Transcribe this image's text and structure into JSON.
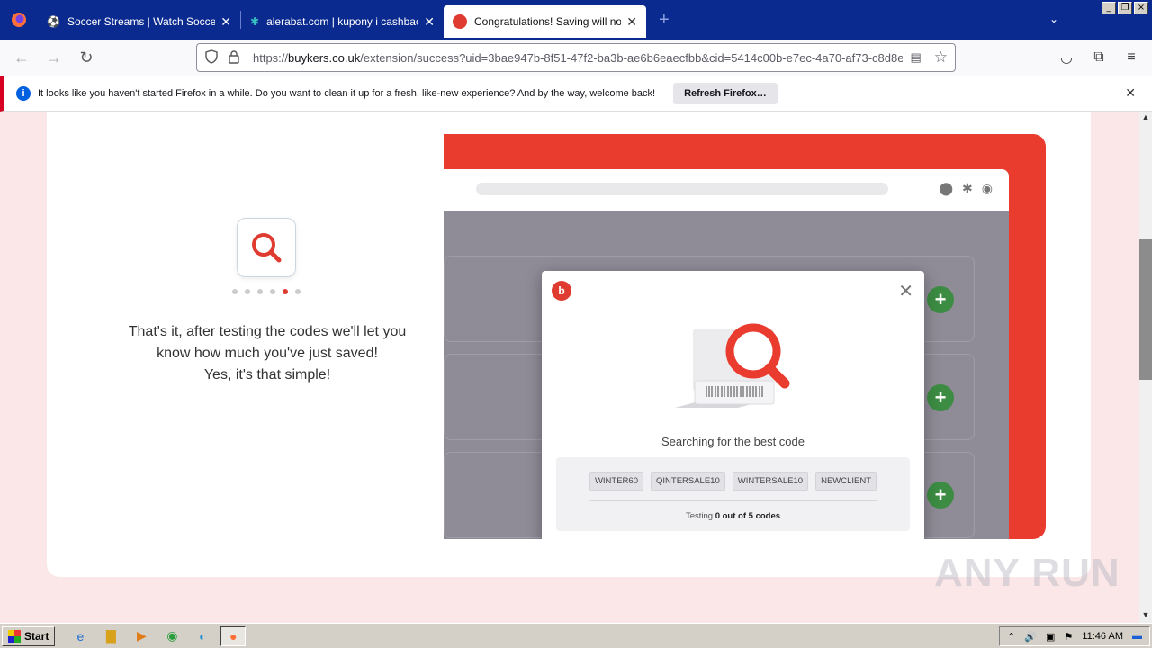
{
  "browser": {
    "tabs": [
      {
        "title": "Soccer Streams | Watch Soccer Or",
        "icon": "soccer-ball-icon"
      },
      {
        "title": "alerabat.com | kupony i cashback",
        "icon": "alerabat-icon"
      },
      {
        "title": "Congratulations! Saving will now b",
        "icon": "buykers-icon",
        "active": true
      }
    ],
    "new_tab": "+",
    "url_prefix": "https://",
    "url_host": "buykers.co.uk",
    "url_path": "/extension/success?uid=3bae947b-8f51-47f2-ba3b-ae6b6eaecfbb&cid=5414c00b-e7ec-4a70-af73-c8d8e"
  },
  "notification": {
    "message": "It looks like you haven't started Firefox in a while. Do you want to clean it up for a fresh, like-new experience? And by the way, welcome back!",
    "button": "Refresh Firefox…"
  },
  "page": {
    "step_dots": [
      false,
      false,
      false,
      false,
      true,
      false
    ],
    "copy_line1": "That's it, after testing the codes we'll let you",
    "copy_line2": "know how much you've just saved!",
    "copy_line3": "Yes, it's that simple!",
    "modal": {
      "searching": "Searching for the best code",
      "codes": [
        "WINTER60",
        "QINTERSALE10",
        "WINTERSALE10",
        "NEWCLIENT"
      ],
      "testing_prefix": "Testing ",
      "testing_count": "0 out of 5 codes"
    },
    "accent_color": "#ea3b2f"
  },
  "watermark": "ANY RUN",
  "taskbar": {
    "start": "Start",
    "clock": "11:46 AM"
  }
}
